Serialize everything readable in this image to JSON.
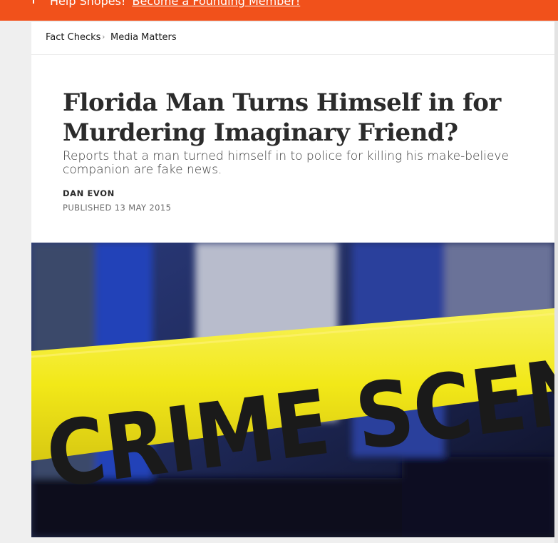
{
  "banner": {
    "text": "Help Snopes!",
    "link": "Become a Founding Member!"
  },
  "breadcrumb": {
    "items": [
      "Fact Checks",
      "Media Matters"
    ],
    "separator": "›"
  },
  "article": {
    "title": "Florida Man Turns Himself in for Murdering Imaginary Friend?",
    "subtitle": "Reports that a man turned himself in to police for killing his make-believe companion are fake news.",
    "author": "DAN EVON",
    "published": "PUBLISHED 13 MAY 2015"
  },
  "hero_image": {
    "tape_text": "CRIME SCENE - DO NOT ENTER",
    "tape_color": "#f2e818"
  },
  "colors": {
    "banner": "#f1511b",
    "page_bg": "#efefef",
    "card_bg": "#ffffff"
  }
}
